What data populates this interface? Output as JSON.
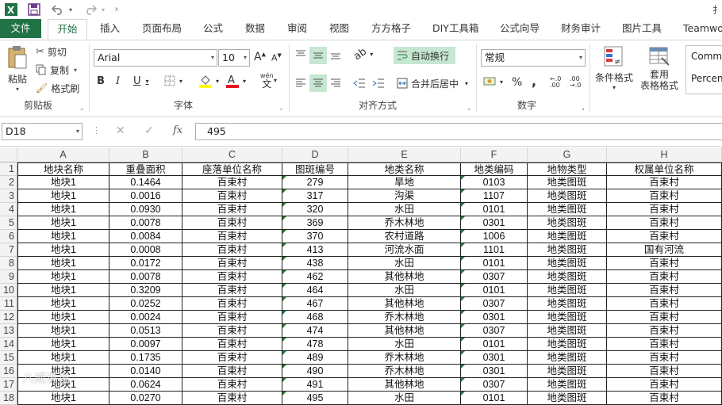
{
  "quick_access": {
    "excel_icon": "excel-icon",
    "save": "save-icon",
    "undo": "undo-icon",
    "redo": "redo-icon",
    "customize": "customize-icon"
  },
  "tabs": [
    "文件",
    "开始",
    "插入",
    "页面布局",
    "公式",
    "数据",
    "审阅",
    "视图",
    "方方格子",
    "DIY工具箱",
    "公式向导",
    "财务审计",
    "图片工具",
    "Teamwo"
  ],
  "ribbon": {
    "clipboard": {
      "paste": "粘贴",
      "cut": "剪切",
      "copy": "复制",
      "format_painter": "格式刷",
      "label": "剪贴板"
    },
    "font": {
      "name": "Arial",
      "size": "10",
      "label": "字体",
      "wen": "wén",
      "bold": "B",
      "italic": "I",
      "underline": "U"
    },
    "alignment": {
      "wrap": "自动换行",
      "merge": "合并后居中",
      "label": "对齐方式"
    },
    "number": {
      "format": "常规",
      "label": "数字",
      "percent": "%",
      "comma": ","
    },
    "styles": {
      "conditional": "条件格式",
      "table_line1": "套用",
      "table_line2": "表格格式",
      "style1": "Comm",
      "style2": "Percen"
    }
  },
  "formula_bar": {
    "name_box": "D18",
    "fx": "fx",
    "value": "495"
  },
  "columns": [
    "A",
    "B",
    "C",
    "D",
    "E",
    "F",
    "G",
    "H"
  ],
  "header_row": [
    "地块名称",
    "重叠面积",
    "座落单位名称",
    "图斑编号",
    "地类名称",
    "地类编码",
    "地物类型",
    "权属单位名称"
  ],
  "rows": [
    [
      "地块1",
      "0.1464",
      "百束村",
      "279",
      "旱地",
      "0103",
      "地类图斑",
      "百束村"
    ],
    [
      "地块1",
      "0.0016",
      "百束村",
      "317",
      "沟渠",
      "1107",
      "地类图斑",
      "百束村"
    ],
    [
      "地块1",
      "0.0930",
      "百束村",
      "320",
      "水田",
      "0101",
      "地类图斑",
      "百束村"
    ],
    [
      "地块1",
      "0.0078",
      "百束村",
      "369",
      "乔木林地",
      "0301",
      "地类图斑",
      "百束村"
    ],
    [
      "地块1",
      "0.0084",
      "百束村",
      "370",
      "农村道路",
      "1006",
      "地类图斑",
      "百束村"
    ],
    [
      "地块1",
      "0.0008",
      "百束村",
      "413",
      "河流水面",
      "1101",
      "地类图斑",
      "国有河流"
    ],
    [
      "地块1",
      "0.0172",
      "百束村",
      "438",
      "水田",
      "0101",
      "地类图斑",
      "百束村"
    ],
    [
      "地块1",
      "0.0078",
      "百束村",
      "462",
      "其他林地",
      "0307",
      "地类图斑",
      "百束村"
    ],
    [
      "地块1",
      "0.3209",
      "百束村",
      "464",
      "水田",
      "0101",
      "地类图斑",
      "百束村"
    ],
    [
      "地块1",
      "0.0252",
      "百束村",
      "467",
      "其他林地",
      "0307",
      "地类图斑",
      "百束村"
    ],
    [
      "地块1",
      "0.0024",
      "百束村",
      "468",
      "乔木林地",
      "0301",
      "地类图斑",
      "百束村"
    ],
    [
      "地块1",
      "0.0513",
      "百束村",
      "474",
      "其他林地",
      "0307",
      "地类图斑",
      "百束村"
    ],
    [
      "地块1",
      "0.0097",
      "百束村",
      "478",
      "水田",
      "0101",
      "地类图斑",
      "百束村"
    ],
    [
      "地块1",
      "0.1735",
      "百束村",
      "489",
      "乔木林地",
      "0301",
      "地类图斑",
      "百束村"
    ],
    [
      "地块1",
      "0.0140",
      "百束村",
      "490",
      "乔木林地",
      "0301",
      "地类图斑",
      "百束村"
    ],
    [
      "地块1",
      "0.0624",
      "百束村",
      "491",
      "其他林地",
      "0307",
      "地类图斑",
      "百束村"
    ],
    [
      "地块1",
      "0.0270",
      "百束村",
      "495",
      "水田",
      "0101",
      "地类图斑",
      "百束村"
    ]
  ],
  "row_numbers": [
    "1",
    "2",
    "3",
    "4",
    "5",
    "6",
    "7",
    "8",
    "9",
    "10",
    "11",
    "12",
    "13",
    "14",
    "15",
    "16",
    "17",
    "18"
  ],
  "watermark": "八戒说说",
  "colors": {
    "excel_green": "#217346",
    "grid_line": "#222222",
    "header_bg": "#f3f3f3",
    "highlight": "#c6e7d2"
  }
}
